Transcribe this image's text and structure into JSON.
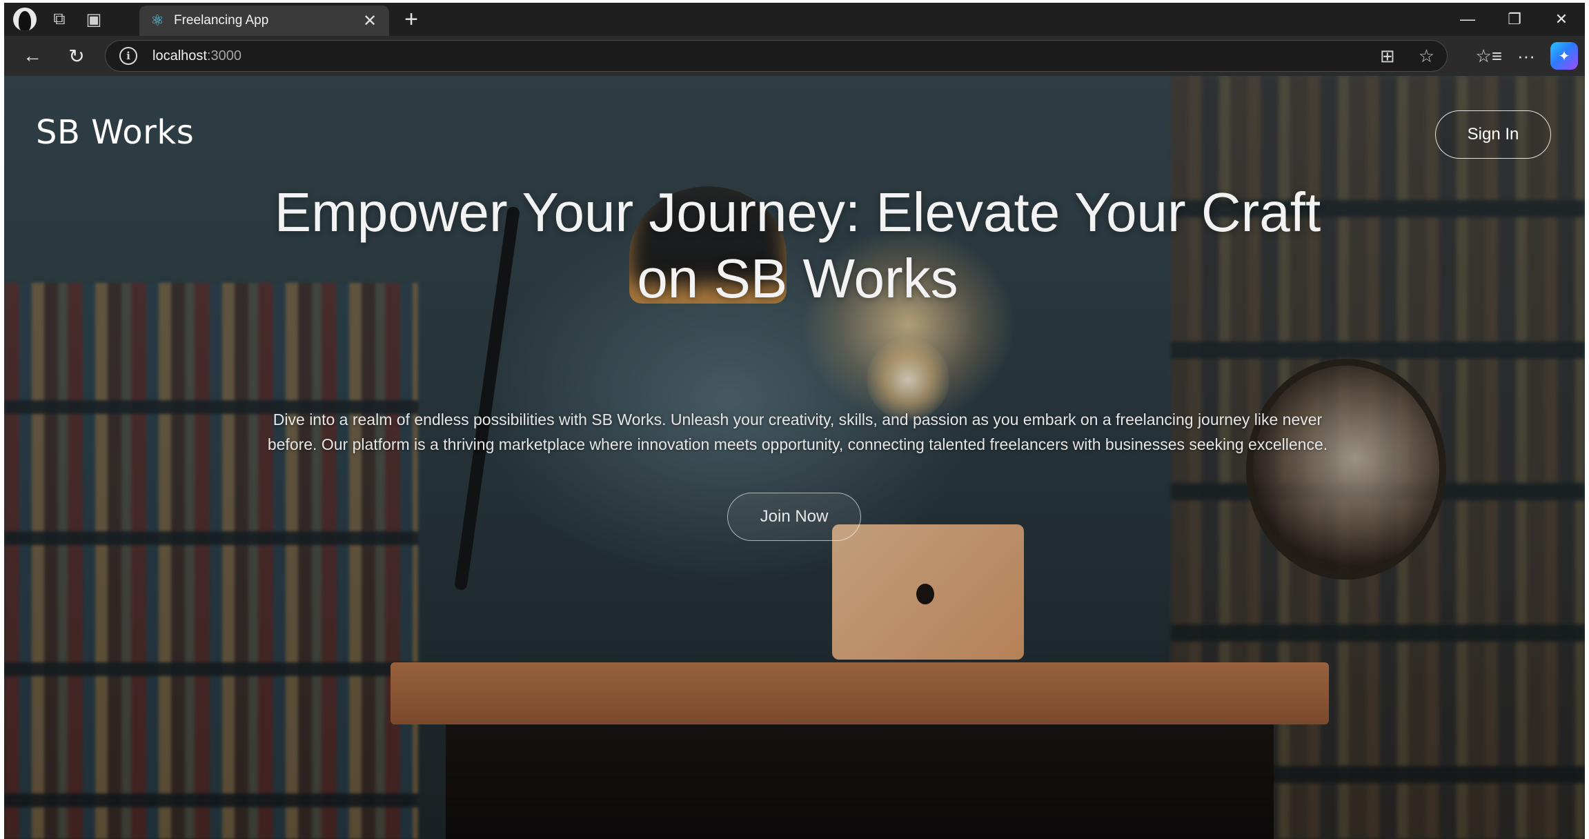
{
  "browser": {
    "tab": {
      "title": "Freelancing App"
    },
    "url": {
      "host": "localhost",
      "port": ":3000"
    },
    "icons": {
      "profile": "profile-icon",
      "workspaces": "workspaces-icon",
      "tab_actions": "tab-actions-icon",
      "favicon": "react-icon",
      "close": "close-icon",
      "new_tab": "plus-icon",
      "back": "back-arrow-icon",
      "refresh": "refresh-icon",
      "info": "info-icon",
      "split_screen": "split-screen-icon",
      "favorite": "star-icon",
      "favorites_list": "favorites-icon",
      "more": "more-icon",
      "copilot": "copilot-icon"
    }
  },
  "site": {
    "brand": "SB Works",
    "nav": {
      "signin_label": "Sign In"
    },
    "hero": {
      "title_line1": "Empower Your Journey: Elevate Your Craft",
      "title_line2": "on SB Works",
      "description_line1": "Dive into a realm of endless possibilities with SB Works. Unleash your creativity, skills, and passion as you embark on a freelancing journey like never",
      "description_line2": "before. Our platform is a thriving marketplace where innovation meets opportunity, connecting talented freelancers with businesses seeking excellence.",
      "cta_label": "Join Now"
    }
  }
}
